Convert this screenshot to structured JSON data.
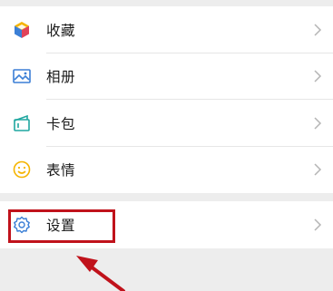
{
  "menu": {
    "items": [
      {
        "label": "收藏",
        "icon": "cube-icon"
      },
      {
        "label": "相册",
        "icon": "photo-icon"
      },
      {
        "label": "卡包",
        "icon": "wallet-icon"
      },
      {
        "label": "表情",
        "icon": "smiley-icon"
      }
    ],
    "settings": {
      "label": "设置",
      "icon": "gear-icon"
    }
  },
  "colors": {
    "background": "#ededed",
    "accent_green": "#22a65a",
    "accent_blue": "#3b7fd6",
    "accent_teal": "#1fa7a0",
    "accent_yellow": "#f5b400",
    "highlight_red": "#c0121b"
  }
}
